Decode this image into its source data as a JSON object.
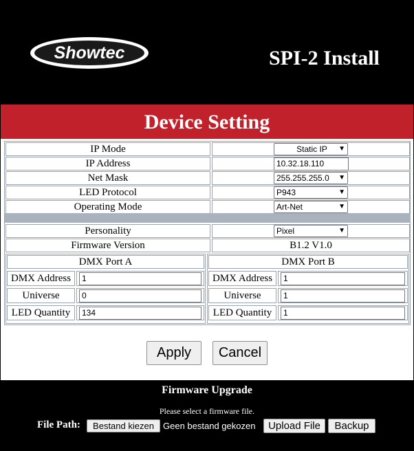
{
  "header": {
    "logo_text": "Showtec",
    "product_title": "SPI-2 Install"
  },
  "banner": {
    "title": "Device Setting"
  },
  "settings": [
    {
      "label": "IP Mode",
      "value": "Static IP",
      "kind": "select"
    },
    {
      "label": "IP Address",
      "value": "10.32.18.110",
      "kind": "text"
    },
    {
      "label": "Net Mask",
      "value": "255.255.255.0",
      "kind": "select"
    },
    {
      "label": "LED Protocol",
      "value": "P943",
      "kind": "select"
    },
    {
      "label": "Operating Mode",
      "value": "Art-Net",
      "kind": "select"
    },
    {
      "label": "Personality",
      "value": "Pixel",
      "kind": "select"
    },
    {
      "label": "Firmware Version",
      "value": "B1.2 V1.0",
      "kind": "static"
    }
  ],
  "ports": [
    {
      "title": "DMX Port A",
      "fields": [
        {
          "label": "DMX Address",
          "value": "1"
        },
        {
          "label": "Universe",
          "value": "0"
        },
        {
          "label": "LED Quantity",
          "value": "134"
        }
      ]
    },
    {
      "title": "DMX Port B",
      "fields": [
        {
          "label": "DMX Address",
          "value": "1"
        },
        {
          "label": "Universe",
          "value": "1"
        },
        {
          "label": "LED Quantity",
          "value": "1"
        }
      ]
    }
  ],
  "actions": {
    "apply": "Apply",
    "cancel": "Cancel"
  },
  "firmware": {
    "title": "Firmware Upgrade",
    "hint": "Please select a firmware file.",
    "file_path_label": "File Path:",
    "choose_file": "Bestand kiezen",
    "no_file": "Geen bestand gekozen",
    "upload": "Upload File",
    "backup": "Backup"
  },
  "colors": {
    "banner_red": "#c0212a",
    "separator_gray": "#a9b2bd",
    "background": "#000000"
  }
}
